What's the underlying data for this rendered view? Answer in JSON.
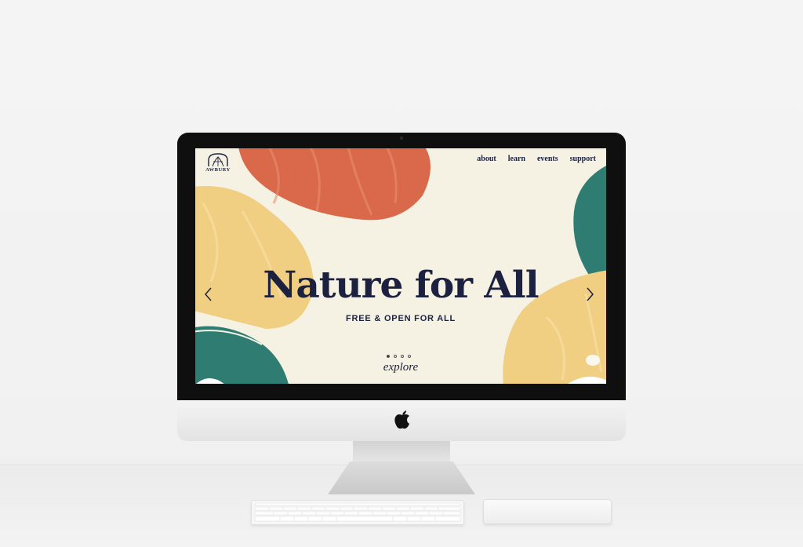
{
  "colors": {
    "navy": "#1d2140",
    "cream": "#f5f1e3",
    "terracotta": "#d9694a",
    "mustard": "#f0cf82",
    "teal": "#2f7d72"
  },
  "site": {
    "logo_text": "AWBURY",
    "nav": {
      "about": "about",
      "learn": "learn",
      "events": "events",
      "support": "support"
    },
    "hero": {
      "headline": "Nature for All",
      "subheadline": "FREE & OPEN FOR ALL",
      "cta": "explore",
      "carousel_total": 4,
      "carousel_active": 1
    },
    "icons": {
      "prev": "chevron-left-icon",
      "next": "chevron-right-icon",
      "logo": "arch-tree-logo-icon"
    }
  },
  "device": {
    "brand_icon": "apple-logo-icon"
  }
}
